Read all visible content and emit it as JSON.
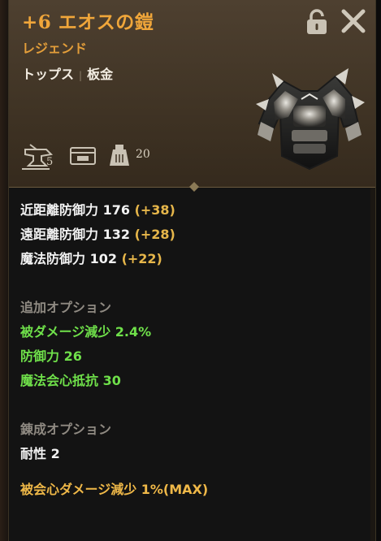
{
  "item": {
    "title": "+6 エオスの鎧",
    "rarity": "レジェンド",
    "category": "トップス",
    "separator": "|",
    "material": "板金"
  },
  "header_icons": {
    "anvil_value": "5",
    "weight_value": "20",
    "lock": "lock-icon",
    "close": "close-icon"
  },
  "base_stats": [
    {
      "label": "近距離防御力 176",
      "bonus": "(+38)"
    },
    {
      "label": "遠距離防御力 132",
      "bonus": "(+28)"
    },
    {
      "label": "魔法防御力 102",
      "bonus": "(+22)"
    }
  ],
  "additional_options": {
    "title": "追加オプション",
    "items": [
      "被ダメージ減少 2.4%",
      "防御力 26",
      "魔法会心抵抗 30"
    ]
  },
  "refine_options": {
    "title": "錬成オプション",
    "items": [
      "耐性 2",
      "被会心ダメージ減少 1%(MAX)"
    ]
  },
  "colors": {
    "title": "#f0a63a",
    "bonus": "#e6b64a",
    "option_green": "#6fe04a",
    "refine_gold": "#efb848",
    "section_gray": "#8f8a82"
  }
}
